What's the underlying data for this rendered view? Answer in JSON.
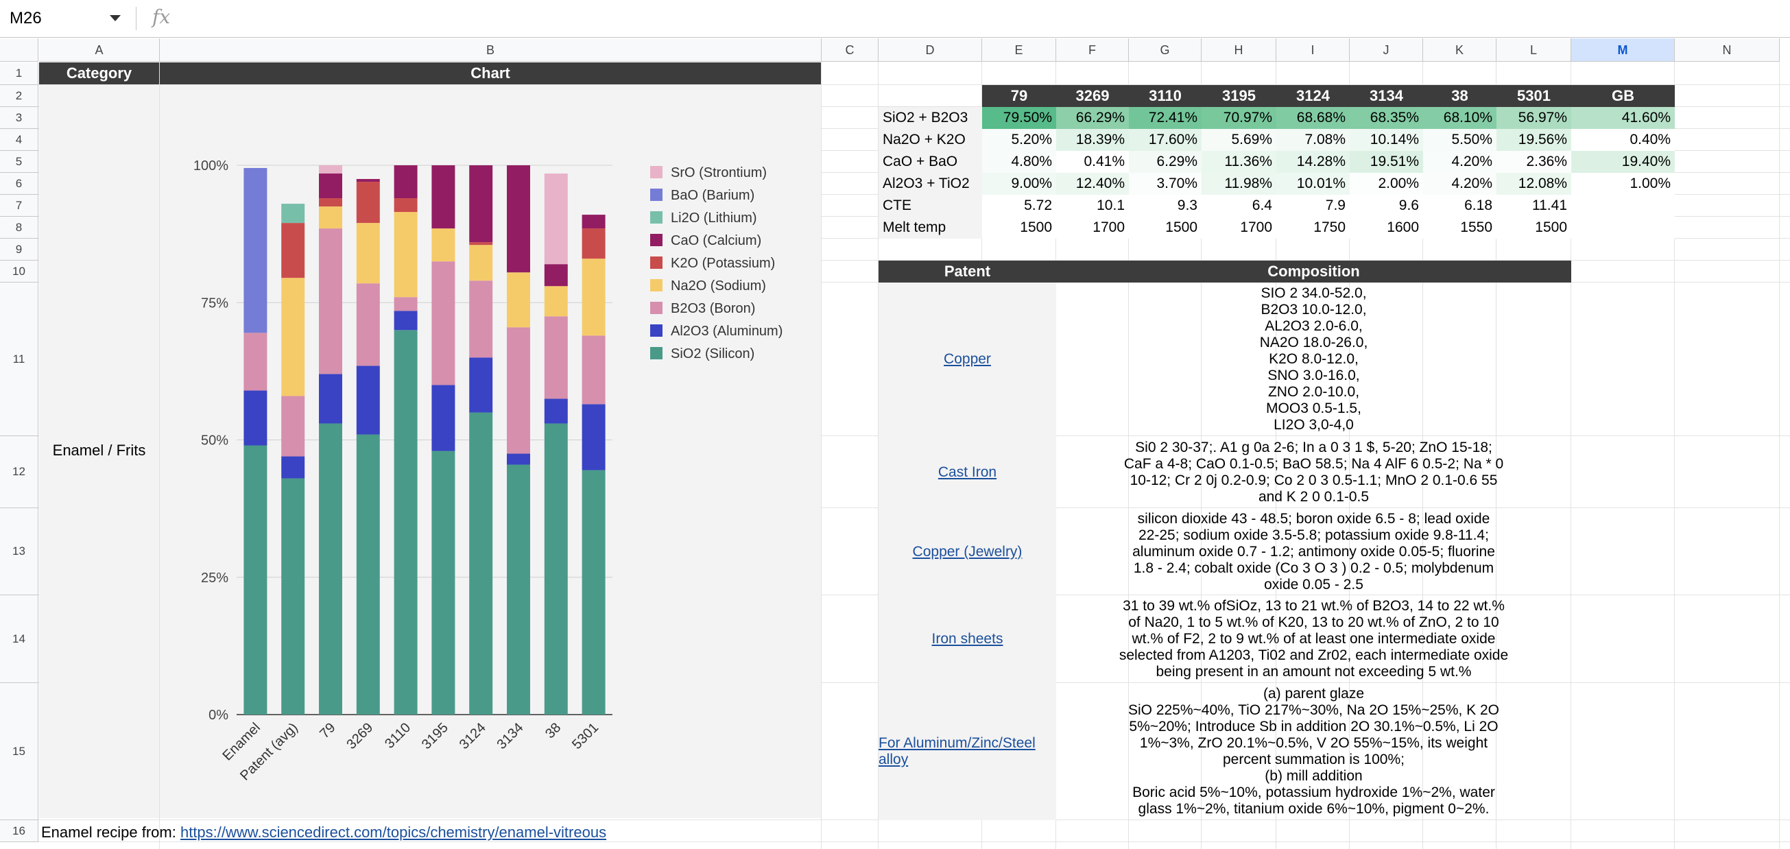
{
  "namebox": "M26",
  "fx_symbol": "fx",
  "columns": [
    "A",
    "B",
    "C",
    "D",
    "E",
    "F",
    "G",
    "H",
    "I",
    "J",
    "K",
    "L",
    "M",
    "N"
  ],
  "selected_column": "M",
  "rows": [
    "1",
    "2",
    "3",
    "4",
    "5",
    "6",
    "7",
    "8",
    "9",
    "10",
    "11",
    "12",
    "13",
    "14",
    "15",
    "16"
  ],
  "headers": {
    "category": "Category",
    "chart": "Chart"
  },
  "category_value": "Enamel / Frits",
  "table": {
    "header": [
      "79",
      "3269",
      "3110",
      "3195",
      "3124",
      "3134",
      "38",
      "5301",
      "GB"
    ],
    "rows": [
      {
        "label": "SiO2 + B2O3",
        "values": [
          "79.50%",
          "66.29%",
          "72.41%",
          "70.97%",
          "68.68%",
          "68.35%",
          "68.10%",
          "56.97%",
          "41.60%"
        ]
      },
      {
        "label": "Na2O + K2O",
        "values": [
          "5.20%",
          "18.39%",
          "17.60%",
          "5.69%",
          "7.08%",
          "10.14%",
          "5.50%",
          "19.56%",
          "0.40%"
        ]
      },
      {
        "label": "CaO + BaO",
        "values": [
          "4.80%",
          "0.41%",
          "6.29%",
          "11.36%",
          "14.28%",
          "19.51%",
          "4.20%",
          "2.36%",
          "19.40%"
        ]
      },
      {
        "label": "Al2O3 + TiO2",
        "values": [
          "9.00%",
          "12.40%",
          "3.70%",
          "11.98%",
          "10.01%",
          "2.00%",
          "4.20%",
          "12.08%",
          "1.00%"
        ]
      },
      {
        "label": "CTE",
        "values": [
          "5.72",
          "10.1",
          "9.3",
          "6.4",
          "7.9",
          "9.6",
          "6.18",
          "11.41",
          ""
        ]
      },
      {
        "label": "Melt temp",
        "values": [
          "1500",
          "1700",
          "1500",
          "1700",
          "1750",
          "1600",
          "1550",
          "1500",
          ""
        ]
      }
    ],
    "cell_colors": [
      [
        "#57bb8a",
        "#8ccfa9",
        "#72c598",
        "#78c89c",
        "#81cba3",
        "#83cca4",
        "#84cca5",
        "#acdcc0",
        "#b7e1c8"
      ],
      [
        "#f7fbf9",
        "#e1f3e8",
        "#e4f4ea",
        "#f6fbf8",
        "#f3faf6",
        "#eef8f2",
        "#f7fbf9",
        "#dff2e6",
        "#ffffff"
      ],
      [
        "#f7fbf9",
        "#ffffff",
        "#f3faf6",
        "#eaf7ef",
        "#e6f5ec",
        "#dcf1e4",
        "#f8fcfa",
        "#fbfdfc",
        "#dcf1e4"
      ],
      [
        "#f1f9f4",
        "#ecf7f0",
        "#fafdfb",
        "#ebf7ef",
        "#eef8f2",
        "#fcfefd",
        "#f9fcfa",
        "#ebf7ef",
        "#ffffff"
      ]
    ]
  },
  "patent_table": {
    "header_patent": "Patent",
    "header_composition": "Composition",
    "rows": [
      {
        "patent": "Copper",
        "composition": "SIO 2 34.0-52.0,\nB2O3 10.0-12.0,\nAL2O3 2.0-6.0,\nNA2O 18.0-26.0,\nK2O 8.0-12.0,\nSNO 3.0-16.0,\nZNO 2.0-10.0,\nMOO3 0.5-1.5,\nLI2O 3,0-4,0"
      },
      {
        "patent": "Cast Iron",
        "composition": "Si0 2 30-37;. A1 g 0a 2-6; In a 0 3 1 $, 5-20; ZnO 15-18;\nCaF a 4-8; CaO 0.1-0.5; BaO 58.5; Na 4 AlF 6 0.5-2; Na * 0\n10-12; Cr 2 0j 0.2-0.9; Co 2 0 3 0.5-1.1; MnO 2 0.1-0.6 55\nand K 2 0 0.1-0.5"
      },
      {
        "patent": "Copper (Jewelry)",
        "composition": "silicon dioxide 43 - 48.5; boron oxide 6.5 - 8; lead oxide\n22-25; sodium oxide 3.5-5.8; potassium oxide 9.8-11.4;\naluminum oxide 0.7 - 1.2; antimony oxide 0.05-5; fluorine\n1.8 - 2.4; cobalt oxide (Co 3 O 3 ) 0.2 - 0.5; molybdenum\noxide 0.05 - 2.5"
      },
      {
        "patent": "Iron sheets",
        "composition": "31 to 39 wt.% ofSiOz, 13 to 21 wt.% of B2O3, 14 to 22 wt.%\nof Na20, 1 to 5 wt.% of K20, 13 to 20 wt.% of ZnO, 2 to 10\nwt.% of F2, 2 to 9 wt.% of at least one intermediate oxide\nselected from A1203, Ti02 and Zr02, each intermediate oxide\nbeing present in an amount not exceeding 5 wt.%"
      },
      {
        "patent": "For Aluminum/Zinc/Steel alloy",
        "composition": "(a) parent glaze\nSiO 225%~40%, TiO 217%~30%, Na 2O 15%~25%, K 2O\n5%~20%; Introduce Sb in addition 2O 30.1%~0.5%, Li 2O\n1%~3%, ZrO 20.1%~0.5%, V 2O 55%~15%, its weight\npercent summation is 100%;\n(b) mill addition\nBoric acid 5%~10%, potassium hydroxide 1%~2%, water\nglass 1%~2%, titanium oxide 6%~10%, pigment 0~2%."
      }
    ]
  },
  "footer": {
    "prefix": "Enamel recipe from: ",
    "link": "https://www.sciencedirect.com/topics/chemistry/enamel-vitreous"
  },
  "chart_data": {
    "type": "bar",
    "stacked": true,
    "categories": [
      "Enamel",
      "Patent (avg)",
      "79",
      "3269",
      "3110",
      "3195",
      "3124",
      "3134",
      "38",
      "5301"
    ],
    "y_ticks": [
      "0%",
      "25%",
      "50%",
      "75%",
      "100%"
    ],
    "ylim": [
      0,
      1
    ],
    "legend_position": "right",
    "series": [
      {
        "name": "SiO2 (Silicon)",
        "color": "#4a9a8a",
        "values": [
          0.49,
          0.43,
          0.53,
          0.51,
          0.7,
          0.48,
          0.55,
          0.455,
          0.53,
          0.445
        ]
      },
      {
        "name": "Al2O3 (Aluminum)",
        "color": "#3943c4",
        "values": [
          0.1,
          0.04,
          0.09,
          0.125,
          0.035,
          0.12,
          0.1,
          0.02,
          0.045,
          0.12
        ]
      },
      {
        "name": "B2O3 (Boron)",
        "color": "#d68fad",
        "values": [
          0.105,
          0.11,
          0.265,
          0.15,
          0.025,
          0.225,
          0.14,
          0.23,
          0.15,
          0.125
        ]
      },
      {
        "name": "Na2O (Sodium)",
        "color": "#f5cb6a",
        "values": [
          0,
          0.215,
          0.04,
          0.11,
          0.155,
          0.06,
          0.065,
          0.1,
          0.055,
          0.14
        ]
      },
      {
        "name": "K2O (Potassium)",
        "color": "#c94c4c",
        "values": [
          0,
          0.1,
          0.015,
          0.075,
          0.025,
          0,
          0.005,
          0,
          0,
          0.055
        ]
      },
      {
        "name": "CaO (Calcium)",
        "color": "#931d62",
        "values": [
          0,
          0,
          0.045,
          0.005,
          0.06,
          0.115,
          0.14,
          0.195,
          0.04,
          0.025
        ]
      },
      {
        "name": "Li2O (Lithium)",
        "color": "#78bfaa",
        "values": [
          0,
          0.035,
          0,
          0,
          0,
          0,
          0,
          0,
          0,
          0
        ]
      },
      {
        "name": "BaO (Barium)",
        "color": "#757cd6",
        "values": [
          0.3,
          0,
          0,
          0,
          0,
          0,
          0,
          0,
          0,
          0
        ]
      },
      {
        "name": "SrO (Strontium)",
        "color": "#e8b3c8",
        "values": [
          0,
          0,
          0.015,
          0,
          0,
          0,
          0,
          0,
          0.165,
          0
        ]
      }
    ]
  }
}
